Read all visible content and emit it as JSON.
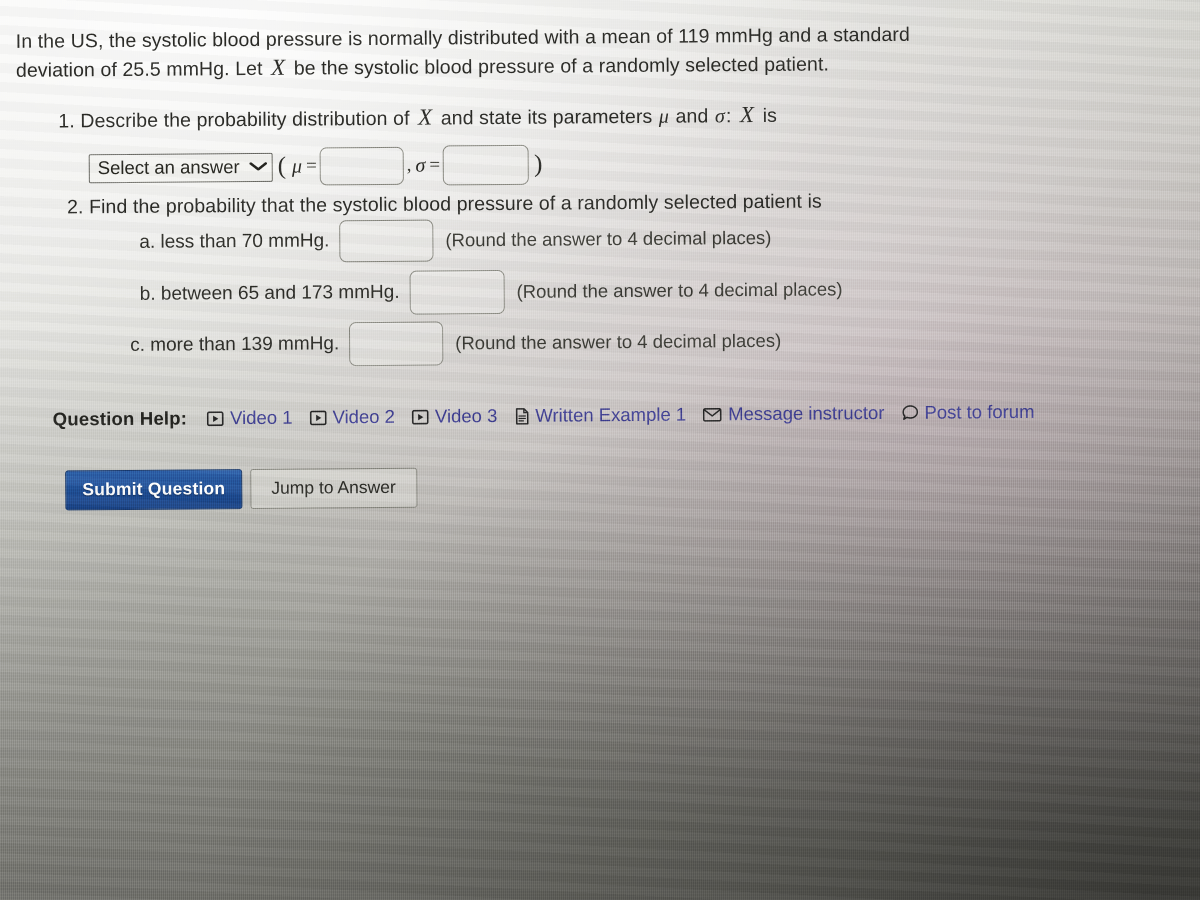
{
  "problem": {
    "intro_line1": "In the US, the systolic blood pressure is normally distributed with a mean of 119 mmHg and a standard",
    "intro_line2": "deviation of 25.5 mmHg. Let",
    "intro_var": "X",
    "intro_line2_cont": "be the systolic blood pressure of a randomly selected patient.",
    "mean": "119 mmHg",
    "std_dev": "25.5 mmHg"
  },
  "part1": {
    "number": "1.",
    "text_before_var": "Describe the probability distribution of",
    "var": "X",
    "text_after_var": "and state its parameters",
    "mu_symbol": "μ",
    "and_word": "and",
    "sigma_symbol": "σ",
    "colon": ":",
    "var2": "X",
    "is_word": "is",
    "select_value": "Select an answer",
    "select_caret": "⌄",
    "open_paren": "(",
    "mu_label": "μ",
    "equals": "=",
    "comma": ",",
    "sigma_label": "σ",
    "equals2": "=",
    "close_paren": ")",
    "mu_input_value": "",
    "sigma_input_value": ""
  },
  "part2": {
    "number": "2.",
    "text": "Find the probability that the systolic blood pressure of a randomly selected patient is",
    "items": [
      {
        "label": "a. less than 70 mmHg.",
        "value": "",
        "hint": "(Round the answer to 4 decimal places)"
      },
      {
        "label": "b. between 65 and 173 mmHg.",
        "value": "",
        "hint": "(Round the answer to 4 decimal places)"
      },
      {
        "label": "c. more than 139 mmHg.",
        "value": "",
        "hint": "(Round the answer to 4 decimal places)"
      }
    ]
  },
  "question_help": {
    "label": "Question Help:",
    "links": [
      {
        "text": "Video 1",
        "icon": "video-play-icon"
      },
      {
        "text": "Video 2",
        "icon": "video-play-icon"
      },
      {
        "text": "Video 3",
        "icon": "video-play-icon"
      },
      {
        "text": "Written Example 1",
        "icon": "document-icon"
      },
      {
        "text": "Message instructor",
        "icon": "envelope-icon"
      },
      {
        "text": "Post to forum",
        "icon": "speech-bubble-icon"
      }
    ]
  },
  "actions": {
    "submit_label": "Submit Question",
    "jump_label": "Jump to Answer"
  },
  "colors": {
    "submit_button": "#1f4d93",
    "link_text": "#3c3c8f",
    "body_text": "#2a2a26"
  }
}
